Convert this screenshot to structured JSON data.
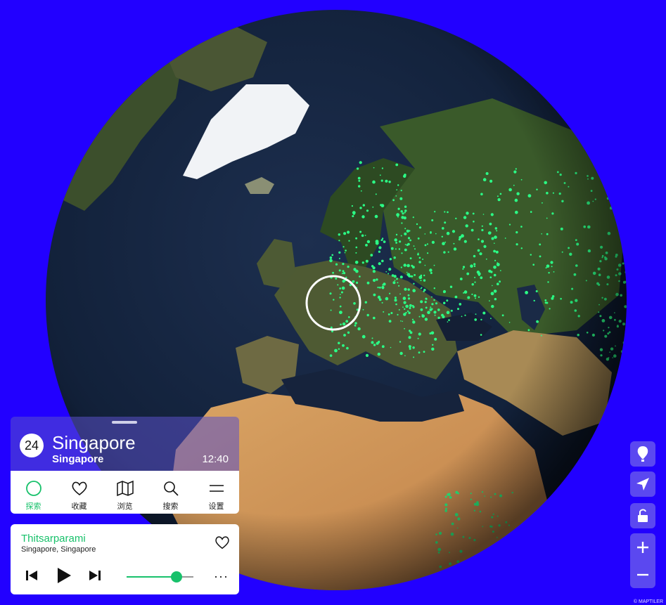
{
  "colors": {
    "background": "#2200ff",
    "accent": "#18c16b",
    "dots": "#2bff86"
  },
  "station": {
    "count": "24",
    "name": "Singapore",
    "country": "Singapore",
    "time": "12:40"
  },
  "nav": {
    "items": [
      {
        "label": "探索",
        "icon": "explore-circle-icon"
      },
      {
        "label": "收藏",
        "icon": "heart-icon"
      },
      {
        "label": "浏览",
        "icon": "map-icon"
      },
      {
        "label": "搜索",
        "icon": "search-icon"
      },
      {
        "label": "设置",
        "icon": "menu-lines-icon"
      }
    ]
  },
  "player": {
    "title": "Thitsarparami",
    "location": "Singapore, Singapore",
    "volume": 0.75,
    "more": "···"
  },
  "map_controls": {
    "buttons": [
      "balloon-icon",
      "locate-arrow-icon",
      "lock-icon",
      "zoom-in-icon",
      "zoom-out-icon"
    ]
  },
  "attribution": "© MAPTILER"
}
